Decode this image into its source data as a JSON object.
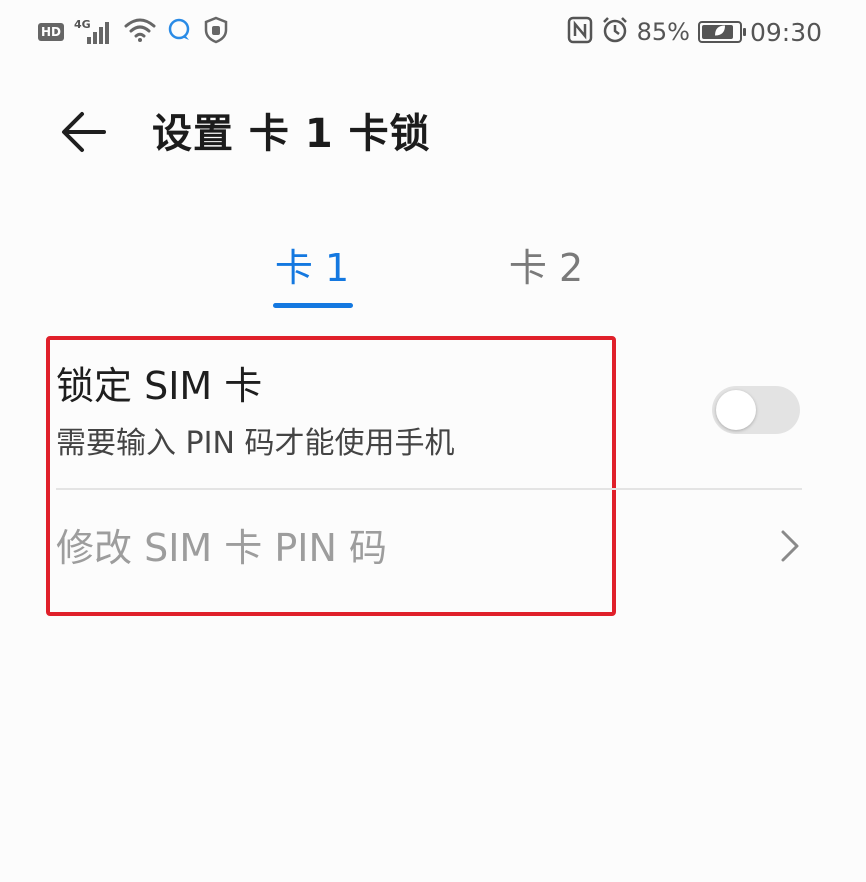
{
  "status_bar": {
    "hd_badge": "HD",
    "network_type": "4G",
    "signal_level": 4,
    "battery_percent": "85%",
    "battery_level": 0.85,
    "time": "09:30",
    "left_icons": [
      "signal-icon",
      "wifi-icon",
      "chat-bubble-icon",
      "hand-shield-icon"
    ],
    "right_icons": [
      "nfc-icon",
      "alarm-icon",
      "battery-icon"
    ]
  },
  "header": {
    "title": "设置 卡 1 卡锁",
    "back_icon": "back-arrow-icon"
  },
  "tabs": [
    {
      "label": "卡 1",
      "active": true
    },
    {
      "label": "卡 2",
      "active": false
    }
  ],
  "settings": {
    "lock_sim": {
      "title": "锁定 SIM 卡",
      "subtitle": "需要输入 PIN 码才能使用手机",
      "enabled": false
    },
    "change_pin": {
      "title": "修改 SIM 卡 PIN 码",
      "enabled": false,
      "icon": "chevron-right-icon"
    }
  },
  "colors": {
    "accent": "#1478e0",
    "highlight_border": "#e0202a",
    "disabled_text": "#9d9d9d"
  }
}
